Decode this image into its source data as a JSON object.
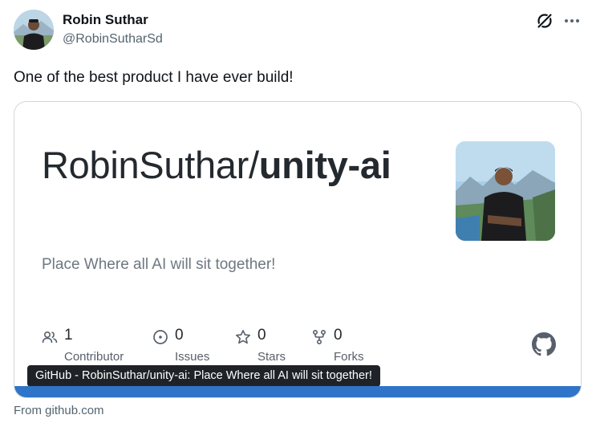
{
  "author": {
    "name": "Robin Suthar",
    "handle": "@RobinSutharSd"
  },
  "post": {
    "text": "One of the best product I have ever build!"
  },
  "card": {
    "repo_owner": "RobinSuthar/",
    "repo_name": "unity-ai",
    "description": "Place Where all AI will sit together!",
    "stats": [
      {
        "value": "1",
        "label": "Contributor",
        "icon": "people-icon"
      },
      {
        "value": "0",
        "label": "Issues",
        "icon": "issue-icon"
      },
      {
        "value": "0",
        "label": "Stars",
        "icon": "star-icon"
      },
      {
        "value": "0",
        "label": "Forks",
        "icon": "fork-icon"
      }
    ],
    "tooltip": "GitHub - RobinSuthar/unity-ai: Place Where all AI will sit together!",
    "accent_color": "#2f74c8"
  },
  "source": "From github.com",
  "icons": [
    "grok-icon",
    "more-icon",
    "github-icon"
  ]
}
